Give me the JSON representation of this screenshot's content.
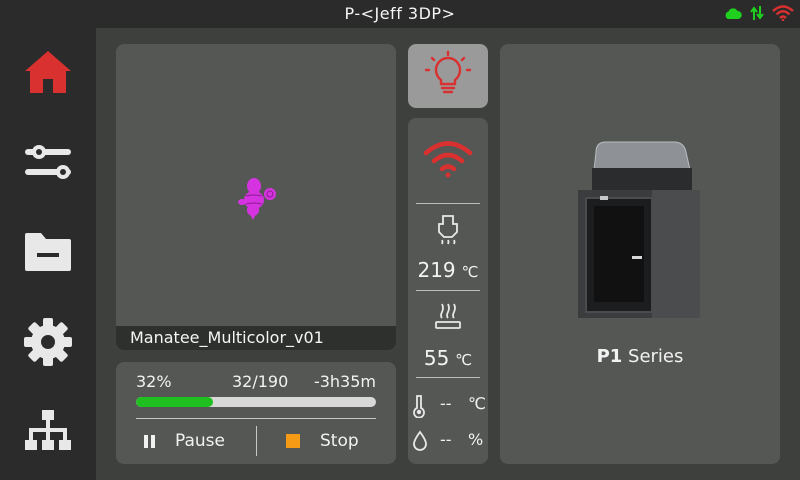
{
  "header": {
    "title": "P-<Jeff 3DP>"
  },
  "colors": {
    "accent_red": "#d93030",
    "progress_green": "#1fbf1f",
    "stop_orange": "#f59a15",
    "model_magenta": "#d633e0",
    "cloud_green": "#1fd01f"
  },
  "sidebar": {
    "items": [
      {
        "icon": "home-icon",
        "active": true
      },
      {
        "icon": "controls-icon",
        "active": false
      },
      {
        "icon": "folder-icon",
        "active": false
      },
      {
        "icon": "gear-icon",
        "active": false
      },
      {
        "icon": "network-icon",
        "active": false
      }
    ]
  },
  "job": {
    "file_name": "Manatee_Multicolor_v01",
    "percent_label": "32%",
    "progress": 0.32,
    "layers": "32/190",
    "remaining": "-3h35m",
    "pause_label": "Pause",
    "stop_label": "Stop"
  },
  "sensors": {
    "nozzle_value": "219",
    "nozzle_unit": "℃",
    "bed_value": "55",
    "bed_unit": "℃",
    "chamber_value": "--",
    "chamber_unit": "℃",
    "humidity_value": "--",
    "humidity_unit": "%"
  },
  "printer": {
    "model_bold": "P1",
    "model_rest": " Series"
  }
}
